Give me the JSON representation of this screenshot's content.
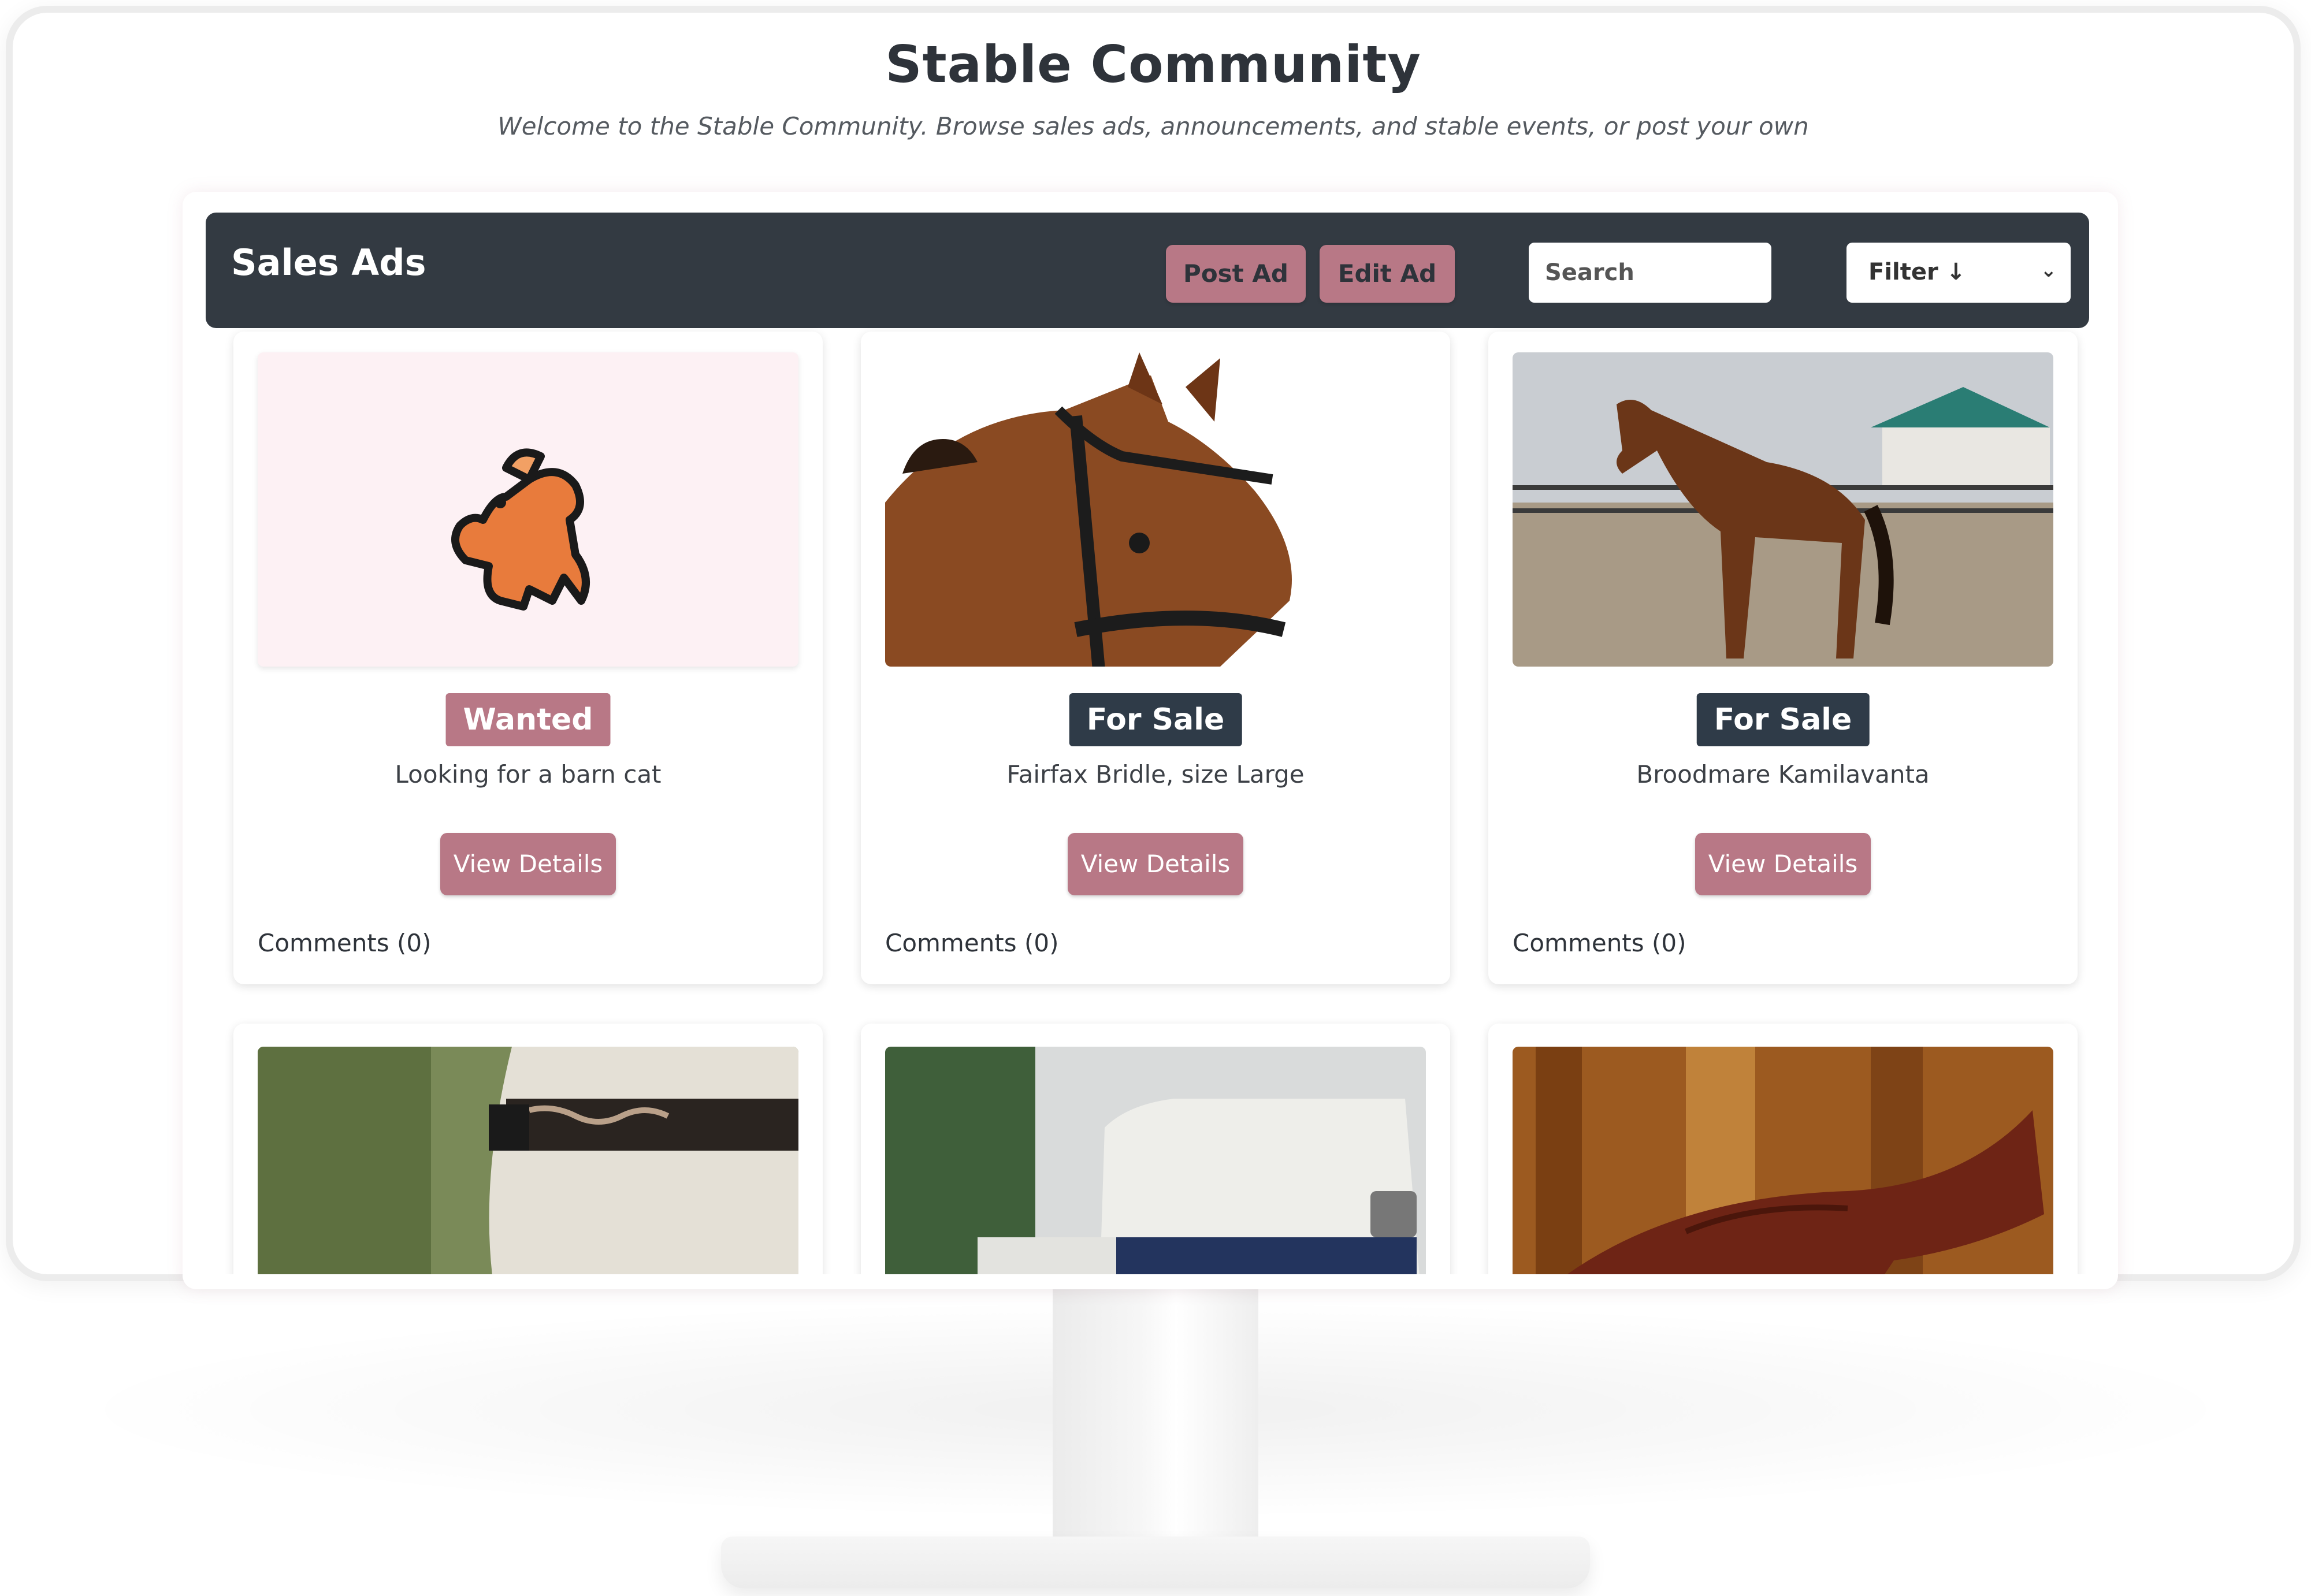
{
  "page": {
    "title": "Stable Community",
    "subtitle": "Welcome to the Stable Community. Browse sales ads, announcements, and stable events, or post your own"
  },
  "toolbar": {
    "title": "Sales Ads",
    "post_label": "Post Ad",
    "edit_label": "Edit Ad",
    "search_placeholder": "Search",
    "filter_label": "Filter ↓",
    "filter_caret": "⌄"
  },
  "colors": {
    "accent": "#b87886",
    "toolbar": "#333a42",
    "sale_tag": "#2f3b48"
  },
  "ads": [
    {
      "tag": "Wanted",
      "tag_type": "wanted",
      "description": "Looking for a barn cat",
      "button": "View Details",
      "comments": "Comments (0)",
      "image": "horse-emoji"
    },
    {
      "tag": "For Sale",
      "tag_type": "sale",
      "description": "Fairfax Bridle, size Large",
      "button": "View Details",
      "comments": "Comments (0)",
      "image": "horse-head-bridle-photo"
    },
    {
      "tag": "For Sale",
      "tag_type": "sale",
      "description": "Broodmare Kamilavanta",
      "button": "View Details",
      "comments": "Comments (0)",
      "image": "bay-horse-field-photo"
    },
    {
      "image": "riding-belt-photo"
    },
    {
      "image": "horse-trailer-photo"
    },
    {
      "image": "saddle-photo"
    }
  ]
}
